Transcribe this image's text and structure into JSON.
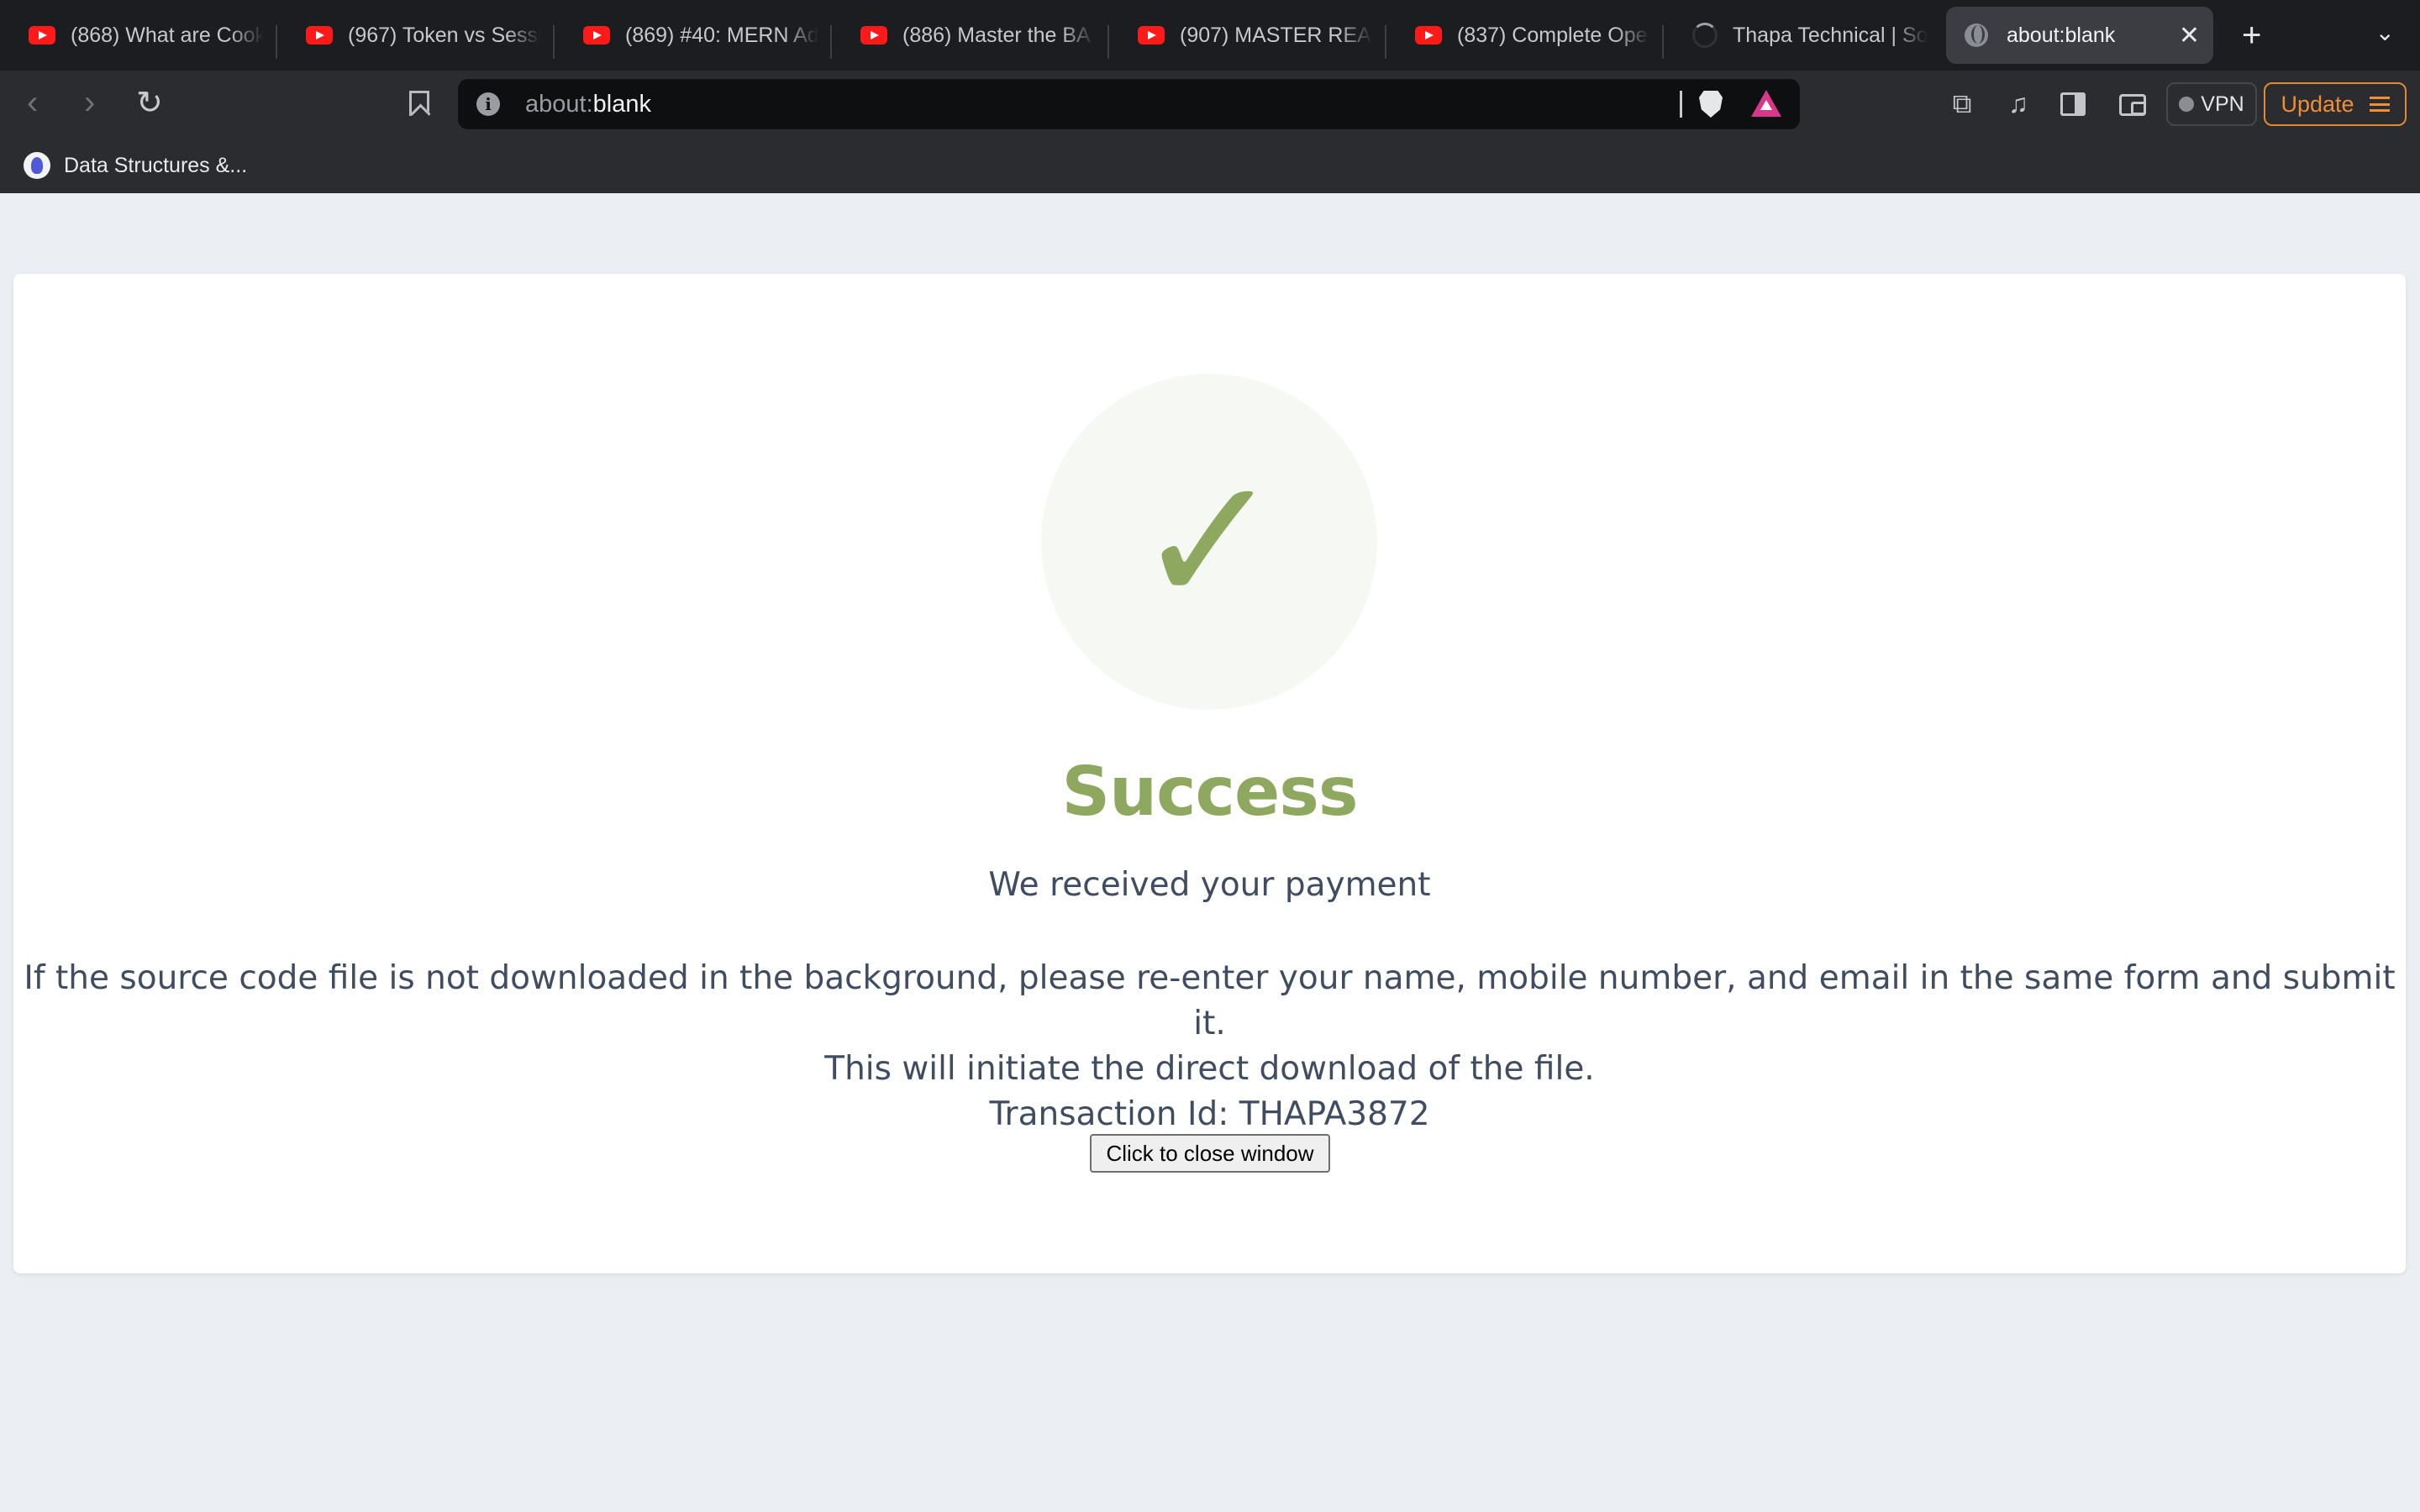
{
  "browser": {
    "tabs": [
      {
        "label": "(868) What are Cook",
        "icon": "youtube-icon"
      },
      {
        "label": "(967) Token vs Sessi",
        "icon": "youtube-icon"
      },
      {
        "label": "(869) #40: MERN Ad",
        "icon": "youtube-icon"
      },
      {
        "label": "(886) Master the BA",
        "icon": "youtube-icon"
      },
      {
        "label": "(907) MASTER REAC",
        "icon": "youtube-icon"
      },
      {
        "label": "(837) Complete Ope",
        "icon": "youtube-icon"
      },
      {
        "label": "Thapa Technical | So",
        "icon": "loading-spinner-icon"
      },
      {
        "label": "about:blank",
        "icon": "globe-icon",
        "active": true
      }
    ],
    "url": {
      "scheme": "about:",
      "host": "blank"
    },
    "vpn_label": "VPN",
    "update_label": "Update",
    "bookmarks": [
      {
        "label": "Data Structures &..."
      }
    ]
  },
  "page": {
    "title": "Success",
    "subtitle": "We received your payment",
    "message_line1": "If the source code file is not downloaded in the background, please re-enter your name, mobile number, and email in the same form and submit it.",
    "message_line2": "This will initiate the direct download of the file.",
    "transaction": "Transaction Id: THAPA3872",
    "close_button": "Click to close window",
    "colors": {
      "accent": "#8ea95f",
      "text": "#404d61",
      "background": "#ebeef2"
    }
  }
}
